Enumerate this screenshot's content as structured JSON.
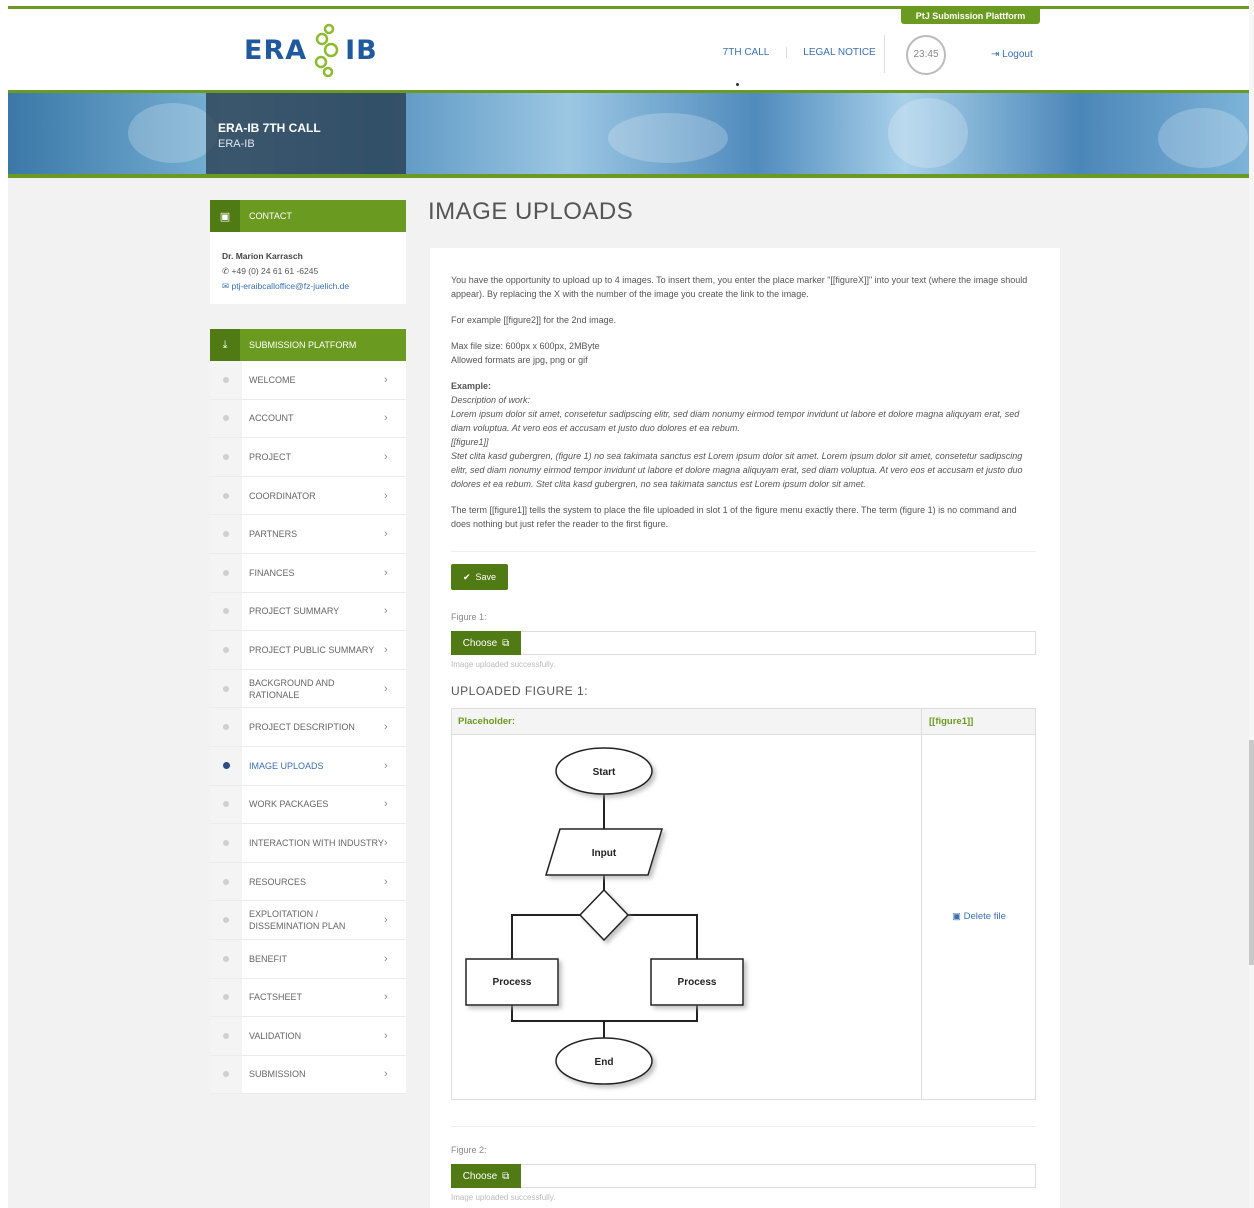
{
  "header": {
    "logo_left": "ERA",
    "logo_right": "IB",
    "platform_tab": "PtJ Submission Plattform",
    "nav": {
      "seventh_call": "7TH CALL",
      "legal_notice": "LEGAL NOTICE"
    },
    "timer": "23:45",
    "logout": "Logout"
  },
  "banner": {
    "title": "ERA-IB 7TH CALL",
    "subtitle": "ERA-IB"
  },
  "contact": {
    "heading": "CONTACT",
    "name": "Dr. Marion Karrasch",
    "phone": "+49 (0) 24 61 61 -6245",
    "email": "ptj-eraibcalloffice@fz-juelich.de"
  },
  "submission": {
    "heading": "SUBMISSION PLATFORM",
    "items": [
      "WELCOME",
      "ACCOUNT",
      "PROJECT",
      "COORDINATOR",
      "PARTNERS",
      "FINANCES",
      "PROJECT SUMMARY",
      "PROJECT PUBLIC SUMMARY",
      "BACKGROUND AND RATIONALE",
      "PROJECT DESCRIPTION",
      "IMAGE UPLOADS",
      "WORK PACKAGES",
      "INTERACTION WITH INDUSTRY",
      "RESOURCES",
      "EXPLOITATION / DISSEMINATION PLAN",
      "BENEFIT",
      "FACTSHEET",
      "VALIDATION",
      "SUBMISSION"
    ],
    "active_index": 10
  },
  "main": {
    "title": "IMAGE UPLOADS",
    "intro1": "You have the opportunity to upload up to 4 images. To insert them, you enter the place marker \"[[figureX]]\" into your text (where the image should appear). By replacing the X with the number of the image you create the link to the image.",
    "intro2": "For example [[figure2]] for the 2nd image.",
    "max_size": "Max file size: 600px x 600px, 2MByte",
    "formats": "Allowed formats are jpg, png or gif",
    "example_title": "Example:",
    "example_desc": "Description of work:",
    "example_text1": "Lorem ipsum dolor sit amet, consetetur sadipscing elitr, sed diam nonumy eirmod tempor invidunt ut labore et dolore magna aliquyam erat, sed diam voluptua. At vero eos et accusam et justo duo dolores et ea rebum.",
    "example_marker": "[[figure1]]",
    "example_text2": "Stet clita kasd gubergren, (figure 1) no sea takimata sanctus est Lorem ipsum dolor sit amet. Lorem ipsum dolor sit amet, consetetur sadipscing elitr, sed diam nonumy eirmod tempor invidunt ut labore et dolore magna aliquyam erat, sed diam voluptua. At vero eos et accusam et justo duo dolores et ea rebum. Stet clita kasd gubergren, no sea takimata sanctus est Lorem ipsum dolor sit amet.",
    "term_note": "The term [[figure1]] tells the system to place the file uploaded in slot 1 of the figure menu exactly there. The term (figure 1) is no command and does nothing but just refer the reader to the first figure.",
    "save": "Save",
    "figure1_label": "Figure 1:",
    "figure2_label": "Figure 2:",
    "choose": "Choose",
    "upload_ok": "Image uploaded successfully.",
    "uploaded_title": "UPLOADED FIGURE 1:",
    "placeholder_label": "Placeholder:",
    "placeholder_code": "[[figure1]]",
    "delete": "Delete file",
    "flow": {
      "start": "Start",
      "input": "Input",
      "process": "Process",
      "end": "End"
    }
  }
}
